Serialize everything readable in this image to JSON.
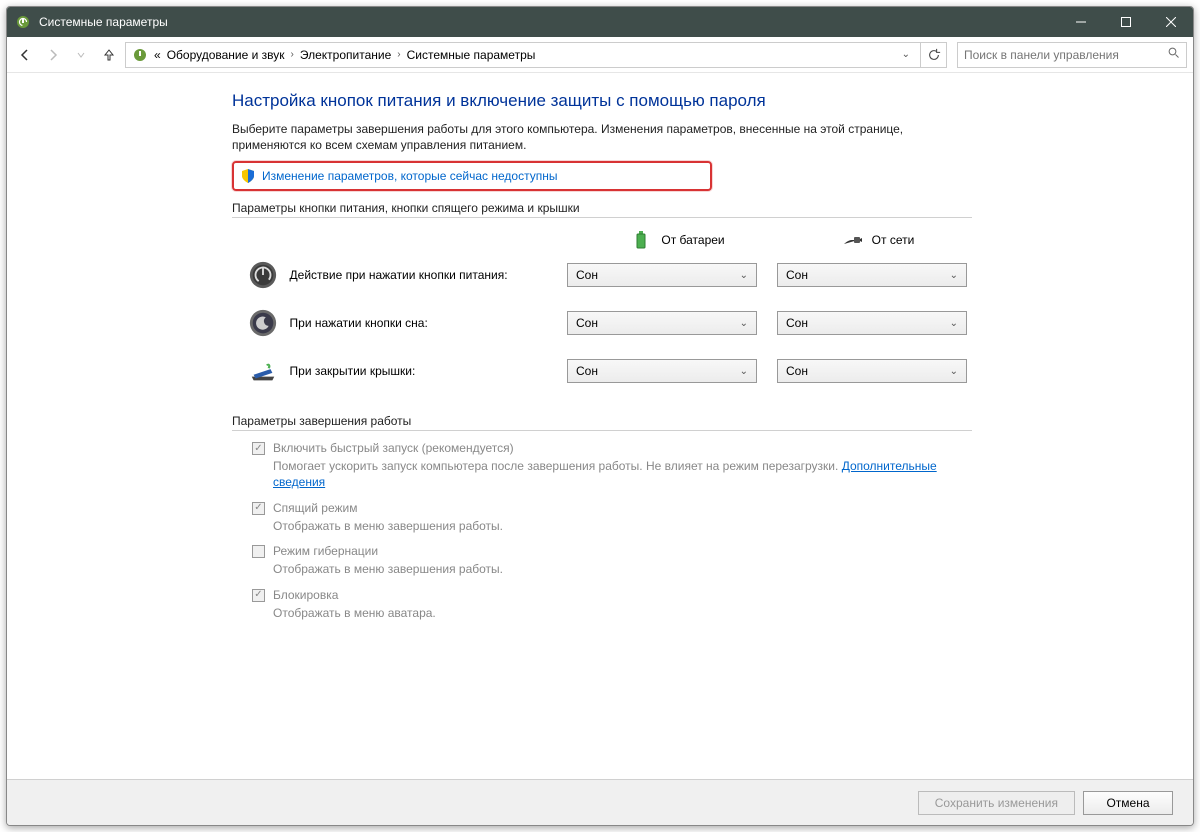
{
  "titlebar": {
    "title": "Системные параметры"
  },
  "breadcrumbs": {
    "prefix": "«",
    "items": [
      "Оборудование и звук",
      "Электропитание",
      "Системные параметры"
    ]
  },
  "search": {
    "placeholder": "Поиск в панели управления"
  },
  "page": {
    "title": "Настройка кнопок питания и включение защиты с помощью пароля",
    "desc": "Выберите параметры завершения работы для этого компьютера. Изменения параметров, внесенные на этой странице, применяются ко всем схемам управления питанием.",
    "admin_link": "Изменение параметров, которые сейчас недоступны"
  },
  "power_section": {
    "label": "Параметры кнопки питания, кнопки спящего режима и крышки",
    "col_battery": "От батареи",
    "col_ac": "От сети",
    "rows": [
      {
        "label": "Действие при нажатии кнопки питания:",
        "battery": "Сон",
        "ac": "Сон"
      },
      {
        "label": "При нажатии кнопки сна:",
        "battery": "Сон",
        "ac": "Сон"
      },
      {
        "label": "При закрытии крышки:",
        "battery": "Сон",
        "ac": "Сон"
      }
    ]
  },
  "shutdown_section": {
    "label": "Параметры завершения работы",
    "items": [
      {
        "checked": true,
        "label": "Включить быстрый запуск (рекомендуется)",
        "desc": "Помогает ускорить запуск компьютера после завершения работы. Не влияет на режим перезагрузки.",
        "link": "Дополнительные сведения"
      },
      {
        "checked": true,
        "label": "Спящий режим",
        "desc": "Отображать в меню завершения работы."
      },
      {
        "checked": false,
        "label": "Режим гибернации",
        "desc": "Отображать в меню завершения работы."
      },
      {
        "checked": true,
        "label": "Блокировка",
        "desc": "Отображать в меню аватара."
      }
    ]
  },
  "footer": {
    "save": "Сохранить изменения",
    "cancel": "Отмена"
  }
}
